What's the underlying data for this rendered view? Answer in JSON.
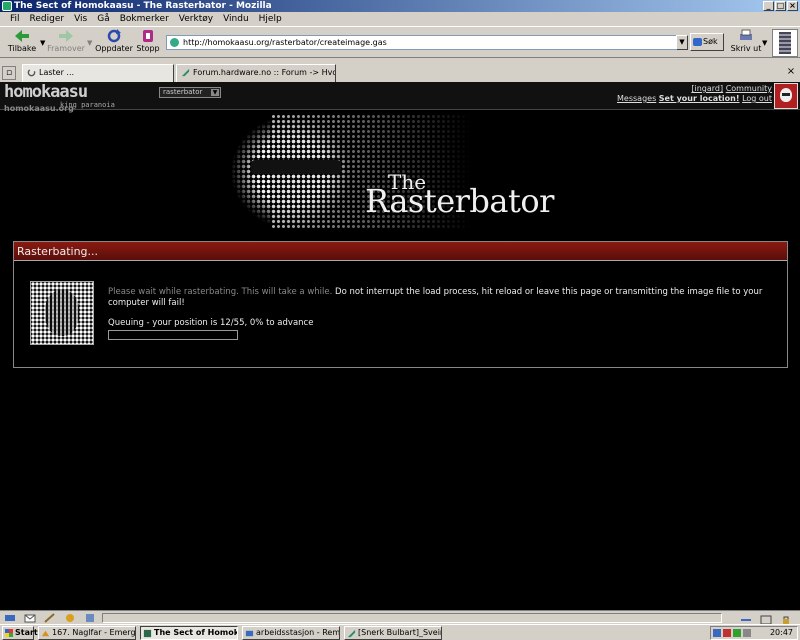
{
  "window": {
    "title": "The Sect of Homokaasu - The Rasterbator - Mozilla",
    "controls": [
      "_",
      "□",
      "×"
    ]
  },
  "menu": [
    "Fil",
    "Rediger",
    "Vis",
    "Gå",
    "Bokmerker",
    "Verktøy",
    "Vindu",
    "Hjelp"
  ],
  "navbar": {
    "back": "Tilbake",
    "forward": "Framover",
    "reload": "Oppdater",
    "stop": "Stopp",
    "url": "http://homokaasu.org/rasterbator/createimage.gas",
    "search": "Søk",
    "print": "Skriv ut"
  },
  "tabs": [
    {
      "label": "Laster ..."
    },
    {
      "label": "Forum.hardware.no :: Forum -> Hvor svæ..."
    }
  ],
  "site": {
    "logo": "homokaasu",
    "logo_sub": "king paranoia",
    "select_value": "rasterbator",
    "user_link": "[ingard]",
    "community": "Community",
    "messages": "Messages",
    "set_location": "Set your location!",
    "logout": "Log out",
    "sitename": "homokaasu.org"
  },
  "banner": {
    "the": "The",
    "name": "Rasterbator"
  },
  "panel": {
    "title": "Rasterbating...",
    "msg_dim": "Please wait while rasterbating. This will take a while.",
    "msg_bright": "Do not interrupt the load process, hit reload or leave this page or transmitting the image file to your computer will fail!",
    "queue": "Queuing - your position is 12/55, 0% to advance",
    "progress": 0
  },
  "taskbar": {
    "start": "Start",
    "tasks": [
      {
        "label": "167. Naglfar - Emerging ...",
        "active": false
      },
      {
        "label": "The Sect of Homokaa...",
        "active": true
      },
      {
        "label": "arbeidsstasjon - Remote ...",
        "active": false
      },
      {
        "label": "[Snerk Bulbart]_Sveinun...",
        "active": false
      }
    ],
    "clock": "20:47"
  },
  "colors": {
    "accent": "#8a1a12",
    "titlebar": "#0a246a"
  }
}
